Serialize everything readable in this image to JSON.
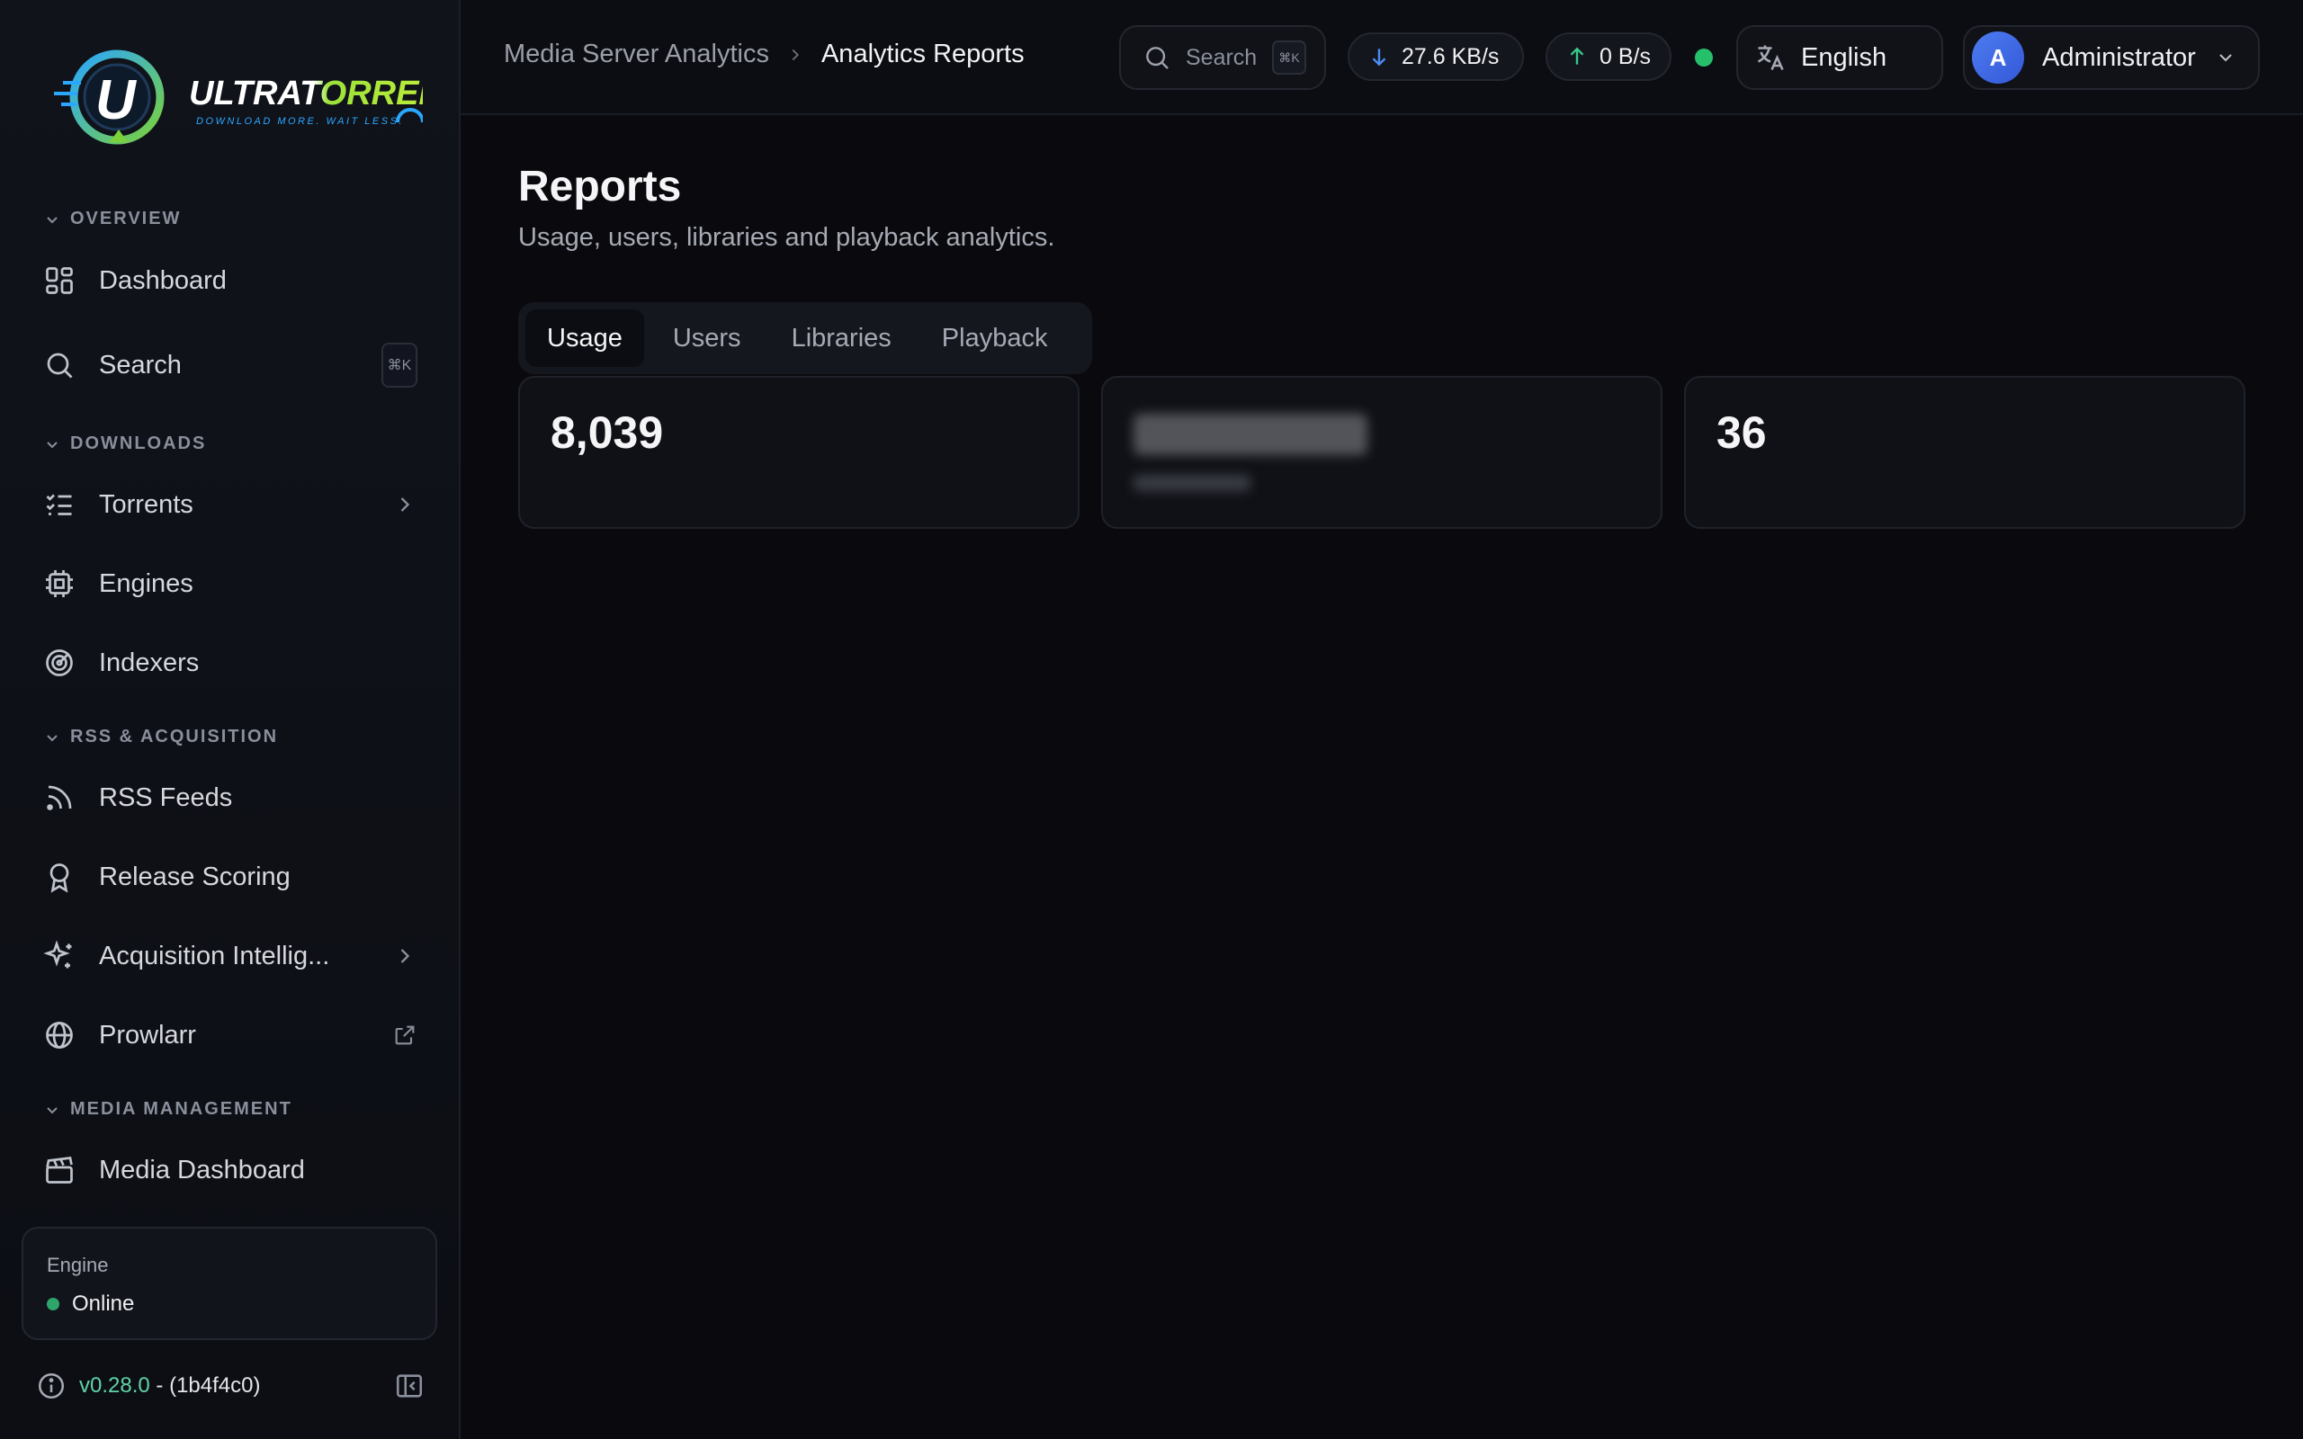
{
  "brand": {
    "name": "ULTRATORRENT",
    "tagline": "DOWNLOAD MORE. WAIT LESS."
  },
  "sidebar": {
    "sections": [
      {
        "title": "OVERVIEW"
      },
      {
        "title": "DOWNLOADS"
      },
      {
        "title": "RSS & ACQUISITION"
      },
      {
        "title": "MEDIA MANAGEMENT"
      }
    ],
    "items": [
      {
        "label": "Dashboard",
        "icon": "dashboard-icon"
      },
      {
        "label": "Search",
        "icon": "search-icon",
        "shortcut": "⌘K"
      },
      {
        "label": "Torrents",
        "icon": "list-check-icon"
      },
      {
        "label": "Engines",
        "icon": "cpu-icon"
      },
      {
        "label": "Indexers",
        "icon": "radar-icon"
      },
      {
        "label": "RSS Feeds",
        "icon": "rss-icon"
      },
      {
        "label": "Release Scoring",
        "icon": "award-icon"
      },
      {
        "label": "Acquisition Intellig...",
        "icon": "sparkles-icon"
      },
      {
        "label": "Prowlarr",
        "icon": "globe-icon"
      },
      {
        "label": "Media Dashboard",
        "icon": "clapperboard-icon"
      }
    ],
    "engine": {
      "label": "Engine",
      "status": "Online"
    },
    "version": {
      "number": "v0.28.0",
      "separator": "-",
      "commit": "(1b4f4c0)"
    }
  },
  "header": {
    "breadcrumb": {
      "parent": "Media Server Analytics",
      "current": "Analytics Reports"
    },
    "search": {
      "placeholder": "Search",
      "shortcut": "⌘K"
    },
    "download_speed": "27.6 KB/s",
    "upload_speed": "0 B/s",
    "language": "English",
    "user": {
      "initial": "A",
      "name": "Administrator"
    }
  },
  "main": {
    "title": "Reports",
    "subtitle": "Usage, users, libraries and playback analytics.",
    "tabs": [
      {
        "label": "Usage"
      },
      {
        "label": "Users"
      },
      {
        "label": "Libraries"
      },
      {
        "label": "Playback"
      }
    ],
    "stats": [
      {
        "value": "8,039",
        "label": ""
      },
      {
        "value": "",
        "label": ""
      },
      {
        "value": "36",
        "label": ""
      }
    ]
  },
  "colors": {
    "accent_blue": "#4b8df8",
    "accent_green": "#36c98a",
    "online_green": "#2ea66a",
    "version_green": "#5fd3a5"
  }
}
